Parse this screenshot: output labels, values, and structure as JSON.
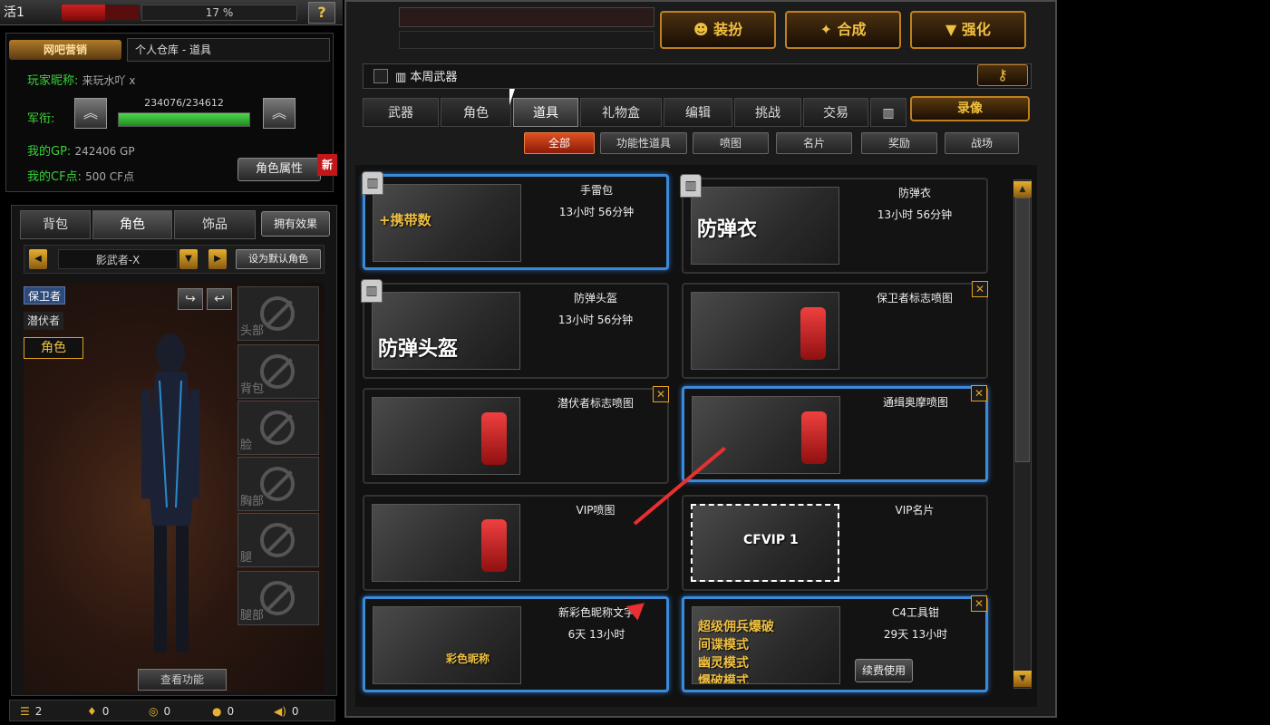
{
  "top_left": {
    "server": "活1",
    "percent": "17 %",
    "help": "?"
  },
  "player": {
    "brand": "网吧营销",
    "warehouse_title": "个人仓库 - 道具",
    "nick_label": "玩家昵称:",
    "nick_value": "来玩水吖 x",
    "rank_label": "军衔:",
    "exp": "234076/234612",
    "exp_fraction": 0.998,
    "gp_label": "我的GP:",
    "gp_value": "242406 GP",
    "cf_label": "我的CF点:",
    "cf_value": "500 CF点",
    "attr_button": "角色属性",
    "new_tag": "新"
  },
  "left_tabs": [
    "背包",
    "角色",
    "饰品"
  ],
  "effect_button": "拥有效果",
  "character": {
    "name": "影武者-X",
    "set_default": "设为默认角色",
    "roles": [
      "保卫者",
      "潜伏者"
    ],
    "role_tab": "角色",
    "slots": [
      "头部",
      "背包",
      "脸",
      "胸部",
      "腿",
      "腿部"
    ],
    "view_button": "查看功能"
  },
  "status": [
    {
      "icon": "list-icon",
      "value": "2"
    },
    {
      "icon": "medal-icon",
      "value": "0"
    },
    {
      "icon": "shield-icon",
      "value": "0"
    },
    {
      "icon": "chat-icon",
      "value": "0"
    },
    {
      "icon": "speaker-icon",
      "value": "0"
    }
  ],
  "top_buttons": [
    "装扮",
    "合成",
    "强化"
  ],
  "weekly": "本周武器",
  "main_tabs": [
    "武器",
    "角色",
    "道具",
    "礼物盒",
    "编辑",
    "挑战",
    "交易",
    "▥"
  ],
  "record_button": "录像",
  "filter_tabs": [
    "全部",
    "功能性道具",
    "喷图",
    "名片",
    "奖励",
    "战场"
  ],
  "items": [
    {
      "name": "手雷包",
      "time": "13小时 56分钟",
      "thumb": "+携带数",
      "shop": true,
      "close": false,
      "highlight": true
    },
    {
      "name": "防弹衣",
      "time": "13小时 56分钟",
      "thumb": "防弹衣",
      "shop": true,
      "close": false,
      "highlight": false
    },
    {
      "name": "防弹头盔",
      "time": "13小时 56分钟",
      "thumb": "防弹头盔",
      "shop": true,
      "close": false,
      "highlight": false
    },
    {
      "name": "保卫者标志喷图",
      "time": "",
      "thumb": "",
      "shop": false,
      "close": true,
      "highlight": false
    },
    {
      "name": "潜伏者标志喷图",
      "time": "",
      "thumb": "",
      "shop": false,
      "close": true,
      "highlight": false
    },
    {
      "name": "通缉奥摩喷图",
      "time": "",
      "thumb": "",
      "shop": false,
      "close": true,
      "highlight": true
    },
    {
      "name": "VIP喷图",
      "time": "",
      "thumb": "",
      "shop": false,
      "close": false,
      "highlight": false
    },
    {
      "name": "VIP名片",
      "time": "",
      "thumb": "CFVIP 1",
      "shop": false,
      "close": false,
      "highlight": false
    },
    {
      "name": "新彩色昵称文字",
      "time": "6天 13小时",
      "thumb": "彩色昵称",
      "shop": false,
      "close": false,
      "highlight": true
    },
    {
      "name": "C4工具钳",
      "time": "29天 13小时",
      "thumb": "",
      "shop": false,
      "close": true,
      "highlight": true,
      "renew": "续费使用",
      "modes": [
        "超级佣兵爆破",
        "间谍模式",
        "幽灵模式",
        "爆破模式"
      ]
    }
  ],
  "accent_color": "#c08020",
  "highlight_color": "#3a8ad8"
}
